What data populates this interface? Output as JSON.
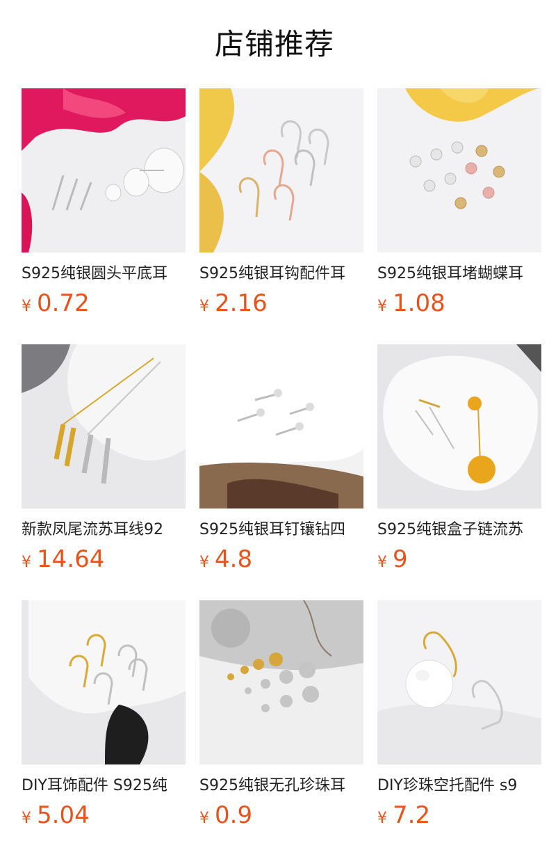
{
  "page": {
    "title": "店铺推荐"
  },
  "products": [
    {
      "name": "S925纯银圆头平底耳",
      "currency": "¥",
      "price": "0.72",
      "image": "flat-pad-stud-pins"
    },
    {
      "name": "S925纯银耳钩配件耳",
      "currency": "¥",
      "price": "2.16",
      "image": "ear-hooks"
    },
    {
      "name": "S925纯银耳堵蝴蝶耳",
      "currency": "¥",
      "price": "1.08",
      "image": "butterfly-ear-backs"
    },
    {
      "name": "新款凤尾流苏耳线92",
      "currency": "¥",
      "price": "14.64",
      "image": "tassel-ear-threads"
    },
    {
      "name": "S925纯银耳钉镶钻四",
      "currency": "¥",
      "price": "4.8",
      "image": "rhinestone-studs"
    },
    {
      "name": "S925纯银盒子链流苏",
      "currency": "¥",
      "price": "9",
      "image": "box-chain-tassel"
    },
    {
      "name": "DIY耳饰配件 S925纯",
      "currency": "¥",
      "price": "5.04",
      "image": "hoop-hooks"
    },
    {
      "name": "S925纯银无孔珍珠耳",
      "currency": "¥",
      "price": "0.9",
      "image": "cup-pearl-studs"
    },
    {
      "name": "DIY珍珠空托配件 s9",
      "currency": "¥",
      "price": "7.2",
      "image": "pearl-hook"
    }
  ]
}
